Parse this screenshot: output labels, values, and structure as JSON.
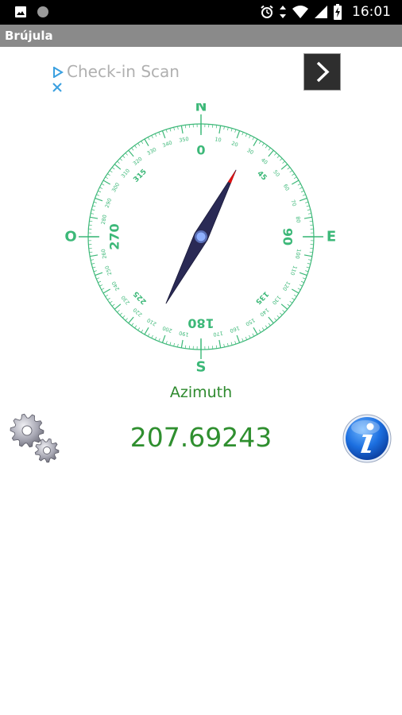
{
  "status_bar": {
    "time": "16:01",
    "icons": [
      "image-icon",
      "circle-dot-icon",
      "alarm-icon",
      "data-arrows-icon",
      "wifi-icon",
      "signal-icon",
      "battery-icon"
    ]
  },
  "app_bar": {
    "title": "Brújula"
  },
  "ad": {
    "text": "Check-in Scan",
    "play_icon": "ad-choices-play-icon",
    "close_icon": "ad-close-icon",
    "arrow_icon": "chevron-right-icon"
  },
  "compass": {
    "cardinals": {
      "north": "N",
      "east": "E",
      "south": "S",
      "west": "O"
    },
    "major_labels": [
      "0",
      "90",
      "180",
      "270"
    ],
    "minor_labels": [
      "45",
      "135",
      "225",
      "315"
    ],
    "fine_labels": [
      "10",
      "20",
      "30",
      "40",
      "50",
      "60",
      "70",
      "80",
      "100",
      "110",
      "120",
      "130",
      "140",
      "150",
      "160",
      "170",
      "190",
      "200",
      "210",
      "220",
      "230",
      "240",
      "250",
      "260",
      "280",
      "290",
      "300",
      "310",
      "320",
      "330",
      "340",
      "350"
    ],
    "needle_heading_deg": 207.69243,
    "colors": {
      "dial": "#3cb878",
      "needle": "#2a2a55",
      "needle_tip": "#e01010",
      "hub": "#8fb0ff"
    }
  },
  "azimuth": {
    "label": "Azimuth",
    "value": "207.69243"
  },
  "controls": {
    "settings_icon": "gears-icon",
    "info_icon": "info-icon"
  }
}
